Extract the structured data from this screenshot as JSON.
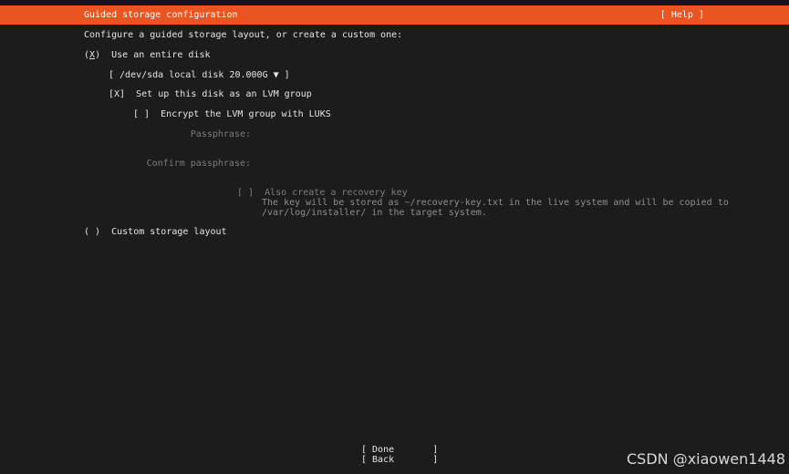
{
  "header": {
    "title": "Guided storage configuration",
    "help_label": "[ Help ]"
  },
  "intro": "Configure a guided storage layout, or create a custom one:",
  "use_entire_disk": {
    "radio_open": "(",
    "radio_mark": "X",
    "radio_close": ")",
    "label": "Use an entire disk"
  },
  "disk_select": {
    "value": "[ /dev/sda local disk 20.000G ▼ ]"
  },
  "lvm": {
    "checkbox": "[X]",
    "label": "Set up this disk as an LVM group"
  },
  "luks": {
    "checkbox": "[ ]",
    "label": "Encrypt the LVM group with LUKS"
  },
  "passphrase": {
    "label": "Passphrase:",
    "value": ""
  },
  "confirm_passphrase": {
    "label": "Confirm passphrase:",
    "value": ""
  },
  "recovery": {
    "checkbox": "[ ]",
    "label": "Also create a recovery key",
    "hint_line1": "The key will be stored as ~/recovery-key.txt in the live system and will be copied to",
    "hint_line2": "/var/log/installer/ in the target system."
  },
  "custom_layout": {
    "radio": "( )",
    "label": "Custom storage layout"
  },
  "buttons": {
    "done": "[ Done       ]",
    "back": "[ Back       ]"
  },
  "watermark": "CSDN @xiaowen1448",
  "colors": {
    "header_bg": "#e95420",
    "page_bg": "#1c1c1c",
    "text": "#e6e6e6",
    "disabled_text": "#7c7c7c"
  }
}
